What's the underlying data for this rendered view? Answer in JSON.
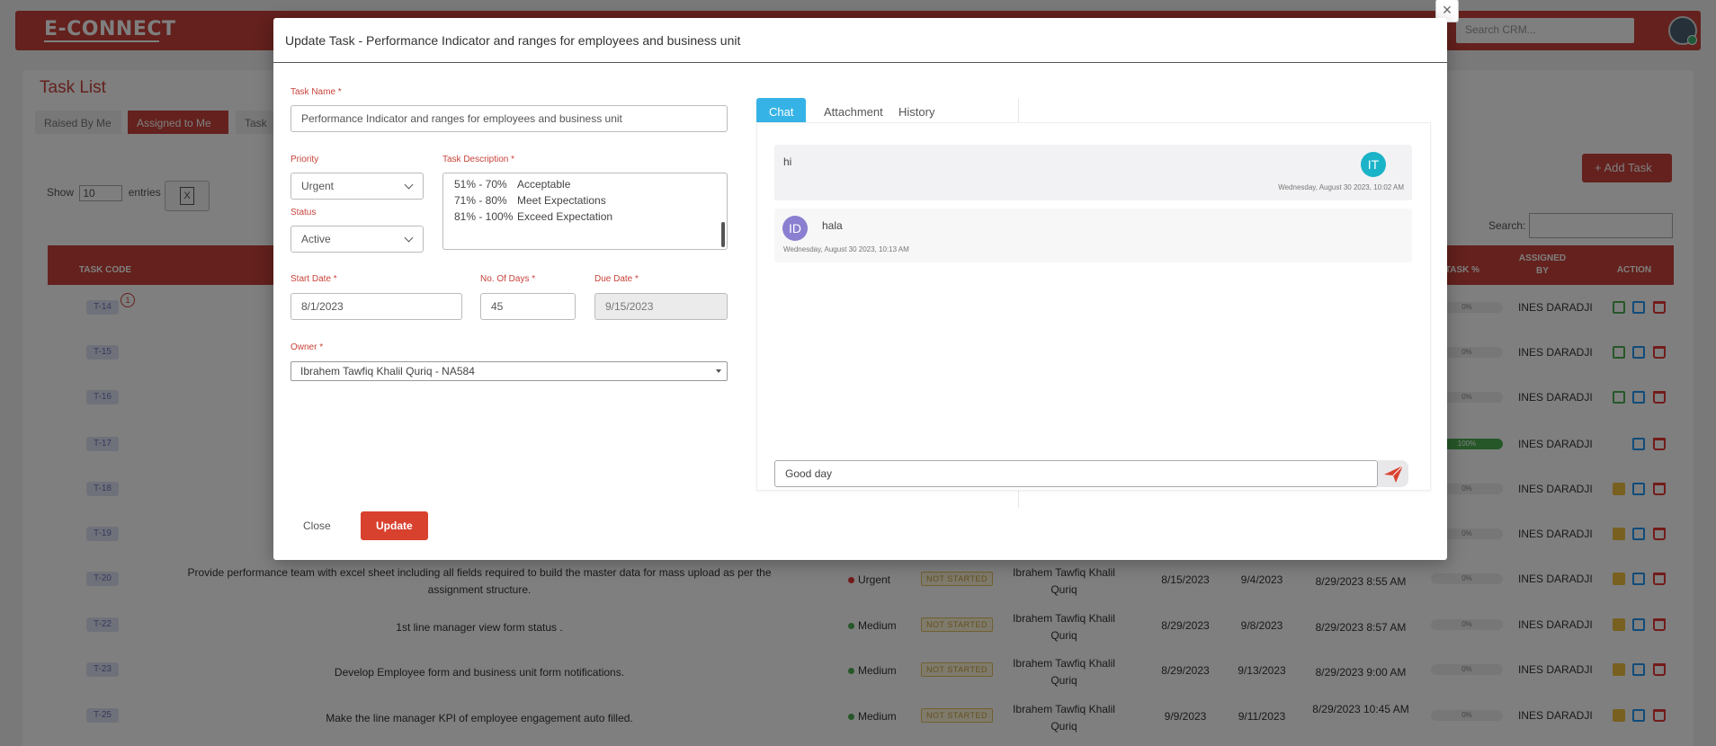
{
  "app": {
    "logo": "E-CONNECT",
    "search_placeholder": "Search CRM..."
  },
  "task_list": {
    "title": "Task List",
    "tabs": [
      "Raised By Me",
      "Assigned to Me",
      "Task"
    ],
    "show_label": "Show",
    "entries_value": "10",
    "entries_label": "entries",
    "add_task_label": "+ Add Task",
    "search_label": "Search:",
    "columns": {
      "task_code": "TASK CODE",
      "task_pct": "TASK %",
      "assigned_by": "ASSIGNED BY",
      "action": "ACTION"
    },
    "notif_count": "1",
    "rows": [
      {
        "code": "T-14",
        "pct": "0%",
        "assigned_by": "INES DARADJI"
      },
      {
        "code": "T-15",
        "pct": "0%",
        "assigned_by": "INES DARADJI"
      },
      {
        "code": "T-16",
        "pct": "0%",
        "assigned_by": "INES DARADJI"
      },
      {
        "code": "T-17",
        "pct": "100%",
        "assigned_by": "INES DARADJI"
      },
      {
        "code": "T-18",
        "pct": "0%",
        "assigned_by": "INES DARADJI"
      },
      {
        "code": "T-19",
        "pct": "0%",
        "assigned_by": "INES DARADJI"
      },
      {
        "code": "T-20",
        "desc": "Provide performance team with excel sheet including all fields required to build the master data for mass upload as per the assignment structure.",
        "priority": "Urgent",
        "status": "NOT STARTED",
        "owner": "Ibrahem Tawfiq Khalil Quriq",
        "start": "8/15/2023",
        "due": "9/4/2023",
        "created": "8/29/2023 8:55 AM",
        "pct": "0%",
        "assigned_by": "INES DARADJI"
      },
      {
        "code": "T-22",
        "desc": "1st line manager view form status .",
        "priority": "Medium",
        "status": "NOT STARTED",
        "owner": "Ibrahem Tawfiq Khalil Quriq",
        "start": "8/29/2023",
        "due": "9/8/2023",
        "created": "8/29/2023 8:57 AM",
        "pct": "0%",
        "assigned_by": "INES DARADJI"
      },
      {
        "code": "T-23",
        "desc": "Develop Employee form and business unit form notifications.",
        "priority": "Medium",
        "status": "NOT STARTED",
        "owner": "Ibrahem Tawfiq Khalil Quriq",
        "start": "8/29/2023",
        "due": "9/13/2023",
        "created": "8/29/2023 9:00 AM",
        "pct": "0%",
        "assigned_by": "INES DARADJI"
      },
      {
        "code": "T-25",
        "desc": "Make the line manager KPI of employee engagement auto filled.",
        "priority": "Medium",
        "status": "NOT STARTED",
        "owner": "Ibrahem Tawfiq Khalil Quriq",
        "start": "9/9/2023",
        "due": "9/11/2023",
        "created": "8/29/2023 10:45 AM",
        "pct": "0%",
        "assigned_by": "INES DARADJI"
      }
    ]
  },
  "modal": {
    "title": "Update Task - Performance Indicator and ranges for employees and business unit",
    "close_x": "×",
    "task_name_label": "Task Name *",
    "task_name_value": "Performance Indicator and ranges for employees and business unit",
    "priority_label": "Priority",
    "priority_value": "Urgent",
    "status_label": "Status",
    "status_value": "Active",
    "description_label": "Task Description *",
    "description_lines": [
      {
        "range": "51% - 70%",
        "text": "Acceptable"
      },
      {
        "range": "71% - 80%",
        "text": "Meet Expectations"
      },
      {
        "range": "81% - 100%",
        "text": "Exceed Expectation"
      }
    ],
    "start_date_label": "Start Date *",
    "start_date_value": "8/1/2023",
    "days_label": "No. Of Days *",
    "days_value": "45",
    "due_date_label": "Due Date *",
    "due_date_value": "9/15/2023",
    "owner_label": "Owner *",
    "owner_value": "Ibrahem Tawfiq Khalil Quriq - NA584",
    "close_button": "Close",
    "update_button": "Update",
    "chat_tabs": [
      "Chat",
      "Attachment",
      "History"
    ],
    "messages": [
      {
        "initials": "IT",
        "text": "hi",
        "time": "Wednesday, August 30 2023, 10:02 AM",
        "color": "#1ab3c8"
      },
      {
        "initials": "ID",
        "text": "hala",
        "time": "Wednesday, August 30 2023, 10:13 AM",
        "color": "#8a7fd0"
      }
    ],
    "chat_input_value": "Good day"
  },
  "colors": {
    "brand": "#c8423a",
    "chat_tab": "#36b3e6",
    "update_btn": "#d9412f"
  }
}
